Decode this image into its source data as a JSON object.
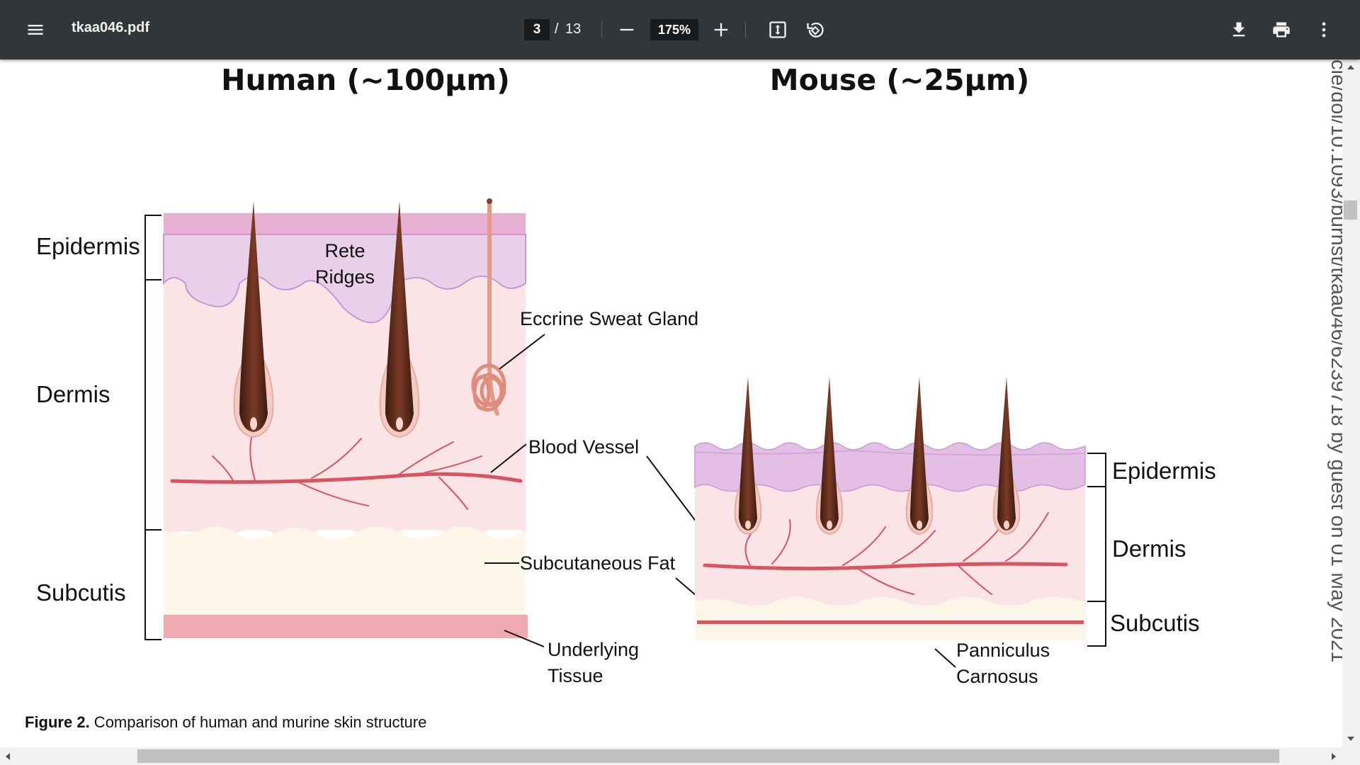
{
  "toolbar": {
    "title": "tkaa046.pdf",
    "current_page": "3",
    "page_separator": "/",
    "total_pages": "13",
    "zoom": "175%",
    "icons": [
      "menu-icon",
      "zoom-out-icon",
      "zoom-in-icon",
      "fit-page-icon",
      "rotate-icon",
      "download-icon",
      "print-icon",
      "more-vert-icon"
    ]
  },
  "figure": {
    "human_title": "Human (~100µm)",
    "mouse_title": "Mouse (~25µm)",
    "human_labels": {
      "epidermis": "Epidermis",
      "dermis": "Dermis",
      "subcutis": "Subcutis"
    },
    "mouse_labels": {
      "epidermis": "Epidermis",
      "dermis": "Dermis",
      "subcutis": "Subcutis"
    },
    "annotations": {
      "rete_1": "Rete",
      "rete_2": "Ridges",
      "sweat_gland": "Eccrine Sweat Gland",
      "blood_vessel": "Blood Vessel",
      "subcutaneous_fat": "Subcutaneous Fat",
      "underlying_1": "Underlying",
      "underlying_2": "Tissue",
      "panniculus_1": "Panniculus",
      "panniculus_2": "Carnosus"
    },
    "caption_bold": "Figure 2.",
    "caption_text": " Comparison of human and murine skin structure"
  },
  "margin_text": "cle/doi/10.1093/burnst/tkaa046/6239718 by guest on 01 May 2021"
}
